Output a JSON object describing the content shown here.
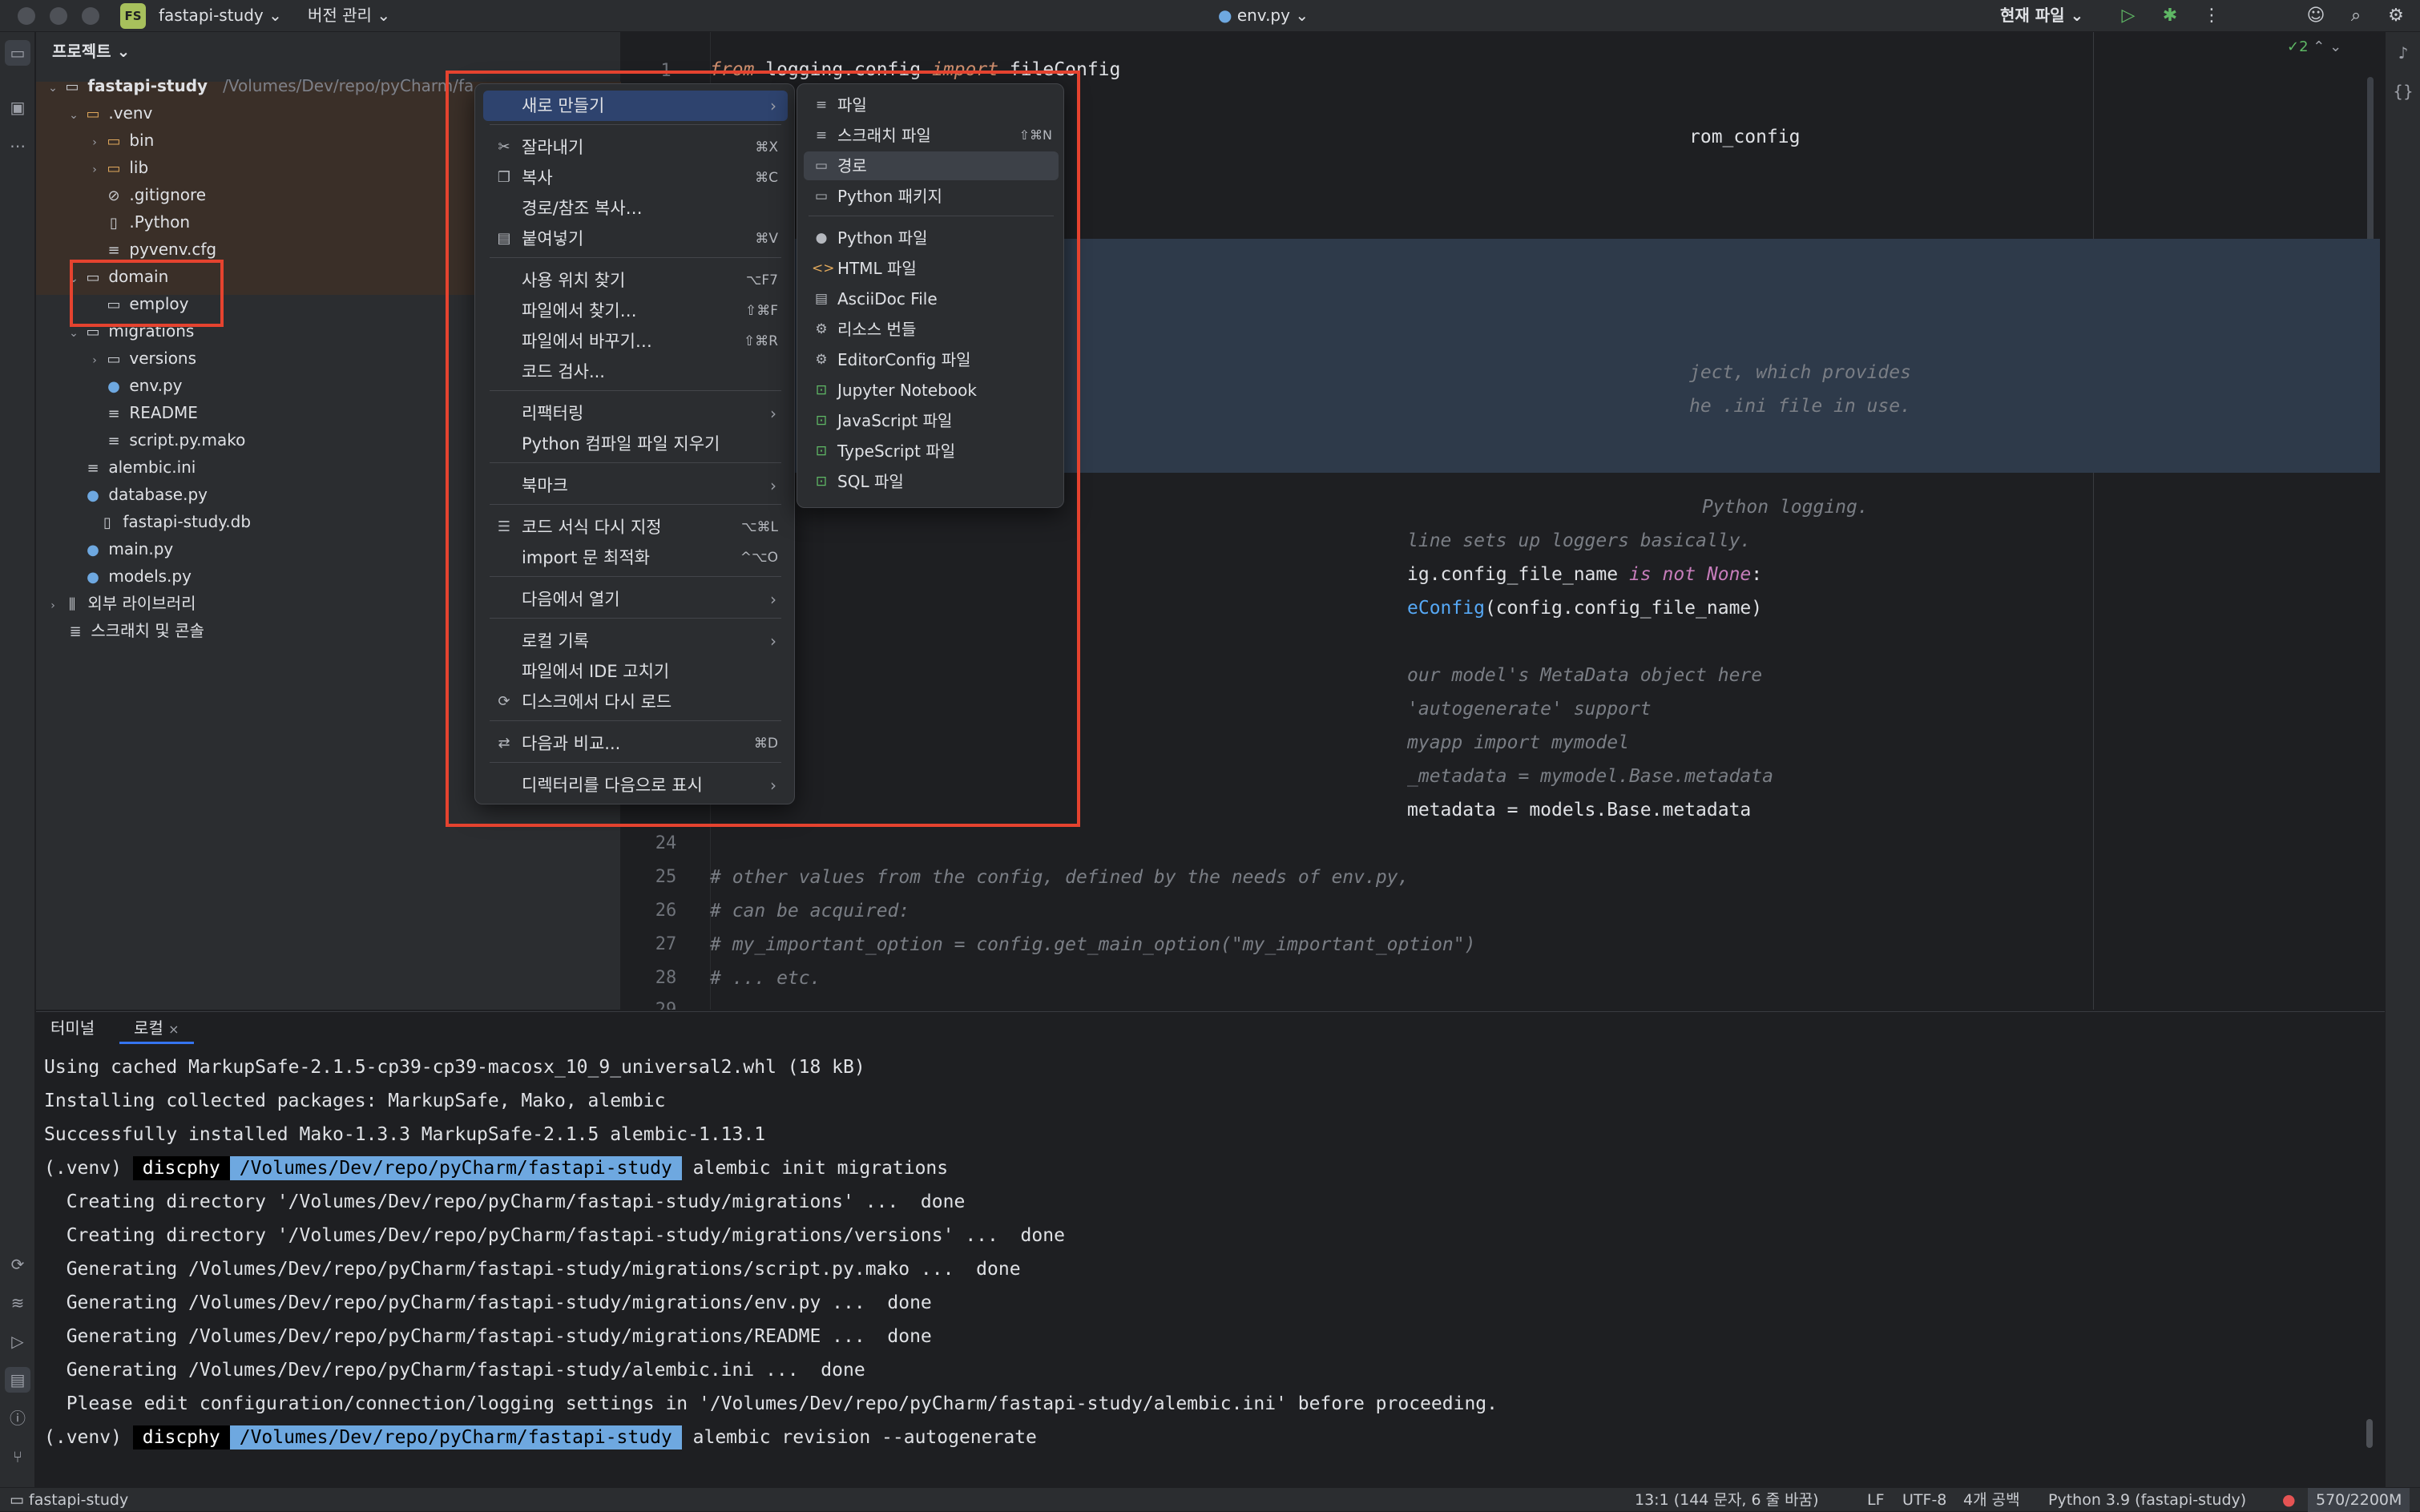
{
  "titlebar": {
    "project_badge": "FS",
    "project_name": "fastapi-study",
    "vcs_menu": "버전 관리",
    "file_tab": "env.py",
    "run_config": "현재 파일"
  },
  "project_panel": {
    "title": "프로젝트",
    "root_name": "fastapi-study",
    "root_path": "/Volumes/Dev/repo/pyCharm/fa",
    "items": {
      "venv": ".venv",
      "bin": "bin",
      "lib": "lib",
      "gitignore": ".gitignore",
      "python": ".Python",
      "pyvenv": "pyvenv.cfg",
      "domain": "domain",
      "employ": "employ",
      "migrations": "migrations",
      "versions": "versions",
      "envpy": "env.py",
      "readme": "README",
      "script": "script.py.mako",
      "alembic_ini": "alembic.ini",
      "database": "database.py",
      "db": "fastapi-study.db",
      "main": "main.py",
      "models": "models.py",
      "ext_libs": "외부 라이브러리",
      "scratches": "스크래치 및 콘솔"
    }
  },
  "editor": {
    "inspection_count": "2",
    "lines": {
      "l1_from": "from",
      "l1_mod": " logging.config ",
      "l1_import": "import",
      "l1_name": " fileConfig",
      "l3_tail": "rom_config",
      "l10": "ject, which provides",
      "l11": "he .ini file in use.",
      "l14": "Python logging.",
      "l15": "line sets up loggers basically.",
      "l16_a": "ig.config_file_name ",
      "l16_is": "is not",
      "l16_none": " None",
      "l16_c": ":",
      "l17_fn": "eConfig",
      "l17_b": "(config.config_file_name)",
      "l19": "our model's MetaData object here",
      "l20": "'autogenerate' support",
      "l21": "myapp import mymodel",
      "l22": "_metadata = mymodel.Base.metadata",
      "l23": "metadata = models.Base.metadata",
      "l25": "# other values from the config, defined by the needs of env.py,",
      "l26": "# can be acquired:",
      "l27": "# my_important_option = config.get_main_option(\"my_important_option\")",
      "l28": "# ... etc."
    },
    "line_numbers": [
      "1",
      "24",
      "25",
      "26",
      "27",
      "28",
      "29"
    ]
  },
  "context_menu": {
    "new": "새로 만들기",
    "cut": "잘라내기",
    "cut_sc": "⌘X",
    "copy": "복사",
    "copy_sc": "⌘C",
    "copy_path": "경로/참조 복사…",
    "paste": "붙여넣기",
    "paste_sc": "⌘V",
    "find_usages": "사용 위치 찾기",
    "find_usages_sc": "⌥F7",
    "find_in_files": "파일에서 찾기…",
    "find_in_files_sc": "⇧⌘F",
    "replace_in_files": "파일에서 바꾸기…",
    "replace_in_files_sc": "⇧⌘R",
    "inspect": "코드 검사...",
    "refactor": "리팩터링",
    "clean_python": "Python 컴파일 파일 지우기",
    "bookmark": "북마크",
    "reformat": "코드 서식 다시 지정",
    "reformat_sc": "⌥⌘L",
    "optimize_imports": "import 문 최적화",
    "optimize_imports_sc": "^⌥O",
    "open_in": "다음에서 열기",
    "local_history": "로컬 기록",
    "repair_ide": "파일에서 IDE 고치기",
    "reload": "디스크에서 다시 로드",
    "compare": "다음과 비교...",
    "compare_sc": "⌘D",
    "mark_dir": "디렉터리를 다음으로 표시"
  },
  "submenu": {
    "file": "파일",
    "scratch": "스크래치 파일",
    "scratch_sc": "⇧⌘N",
    "directory": "경로",
    "python_package": "Python 패키지",
    "python_file": "Python 파일",
    "html_file": "HTML 파일",
    "asciidoc": "AsciiDoc File",
    "resource_bundle": "리소스 번들",
    "editorconfig": "EditorConfig 파일",
    "jupyter": "Jupyter Notebook",
    "javascript": "JavaScript 파일",
    "typescript": "TypeScript 파일",
    "sql": "SQL 파일"
  },
  "terminal": {
    "tab_terminal": "터미널",
    "tab_local": "로컬",
    "prompt_venv": "(.venv)",
    "prompt_user": "discphy",
    "prompt_path": "/Volumes/Dev/repo/pyCharm/fastapi-study",
    "lines": {
      "t1": "Using cached MarkupSafe-2.1.5-cp39-cp39-macosx_10_9_universal2.whl (18 kB)",
      "t2": "Installing collected packages: MarkupSafe, Mako, alembic",
      "t3": "Successfully installed Mako-1.3.3 MarkupSafe-2.1.5 alembic-1.13.1",
      "t4_cmd": " alembic init migrations",
      "t5": "  Creating directory '/Volumes/Dev/repo/pyCharm/fastapi-study/migrations' ...  done",
      "t6": "  Creating directory '/Volumes/Dev/repo/pyCharm/fastapi-study/migrations/versions' ...  done",
      "t7": "  Generating /Volumes/Dev/repo/pyCharm/fastapi-study/migrations/script.py.mako ...  done",
      "t8": "  Generating /Volumes/Dev/repo/pyCharm/fastapi-study/migrations/env.py ...  done",
      "t9": "  Generating /Volumes/Dev/repo/pyCharm/fastapi-study/migrations/README ...  done",
      "t10": "  Generating /Volumes/Dev/repo/pyCharm/fastapi-study/alembic.ini ...  done",
      "t11": "  Please edit configuration/connection/logging settings in '/Volumes/Dev/repo/pyCharm/fastapi-study/alembic.ini' before proceeding.",
      "t12_cmd": " alembic revision --autogenerate"
    }
  },
  "statusbar": {
    "project": "fastapi-study",
    "position": "13:1 (144 문자, 6 줄 바꿈)",
    "line_sep": "LF",
    "encoding": "UTF-8",
    "indent": "4개 공백",
    "interpreter": "Python 3.9 (fastapi-study)",
    "memory": "570/2200M"
  },
  "colors": {
    "accent": "#2e436e",
    "highlight_box": "#e5432f"
  }
}
